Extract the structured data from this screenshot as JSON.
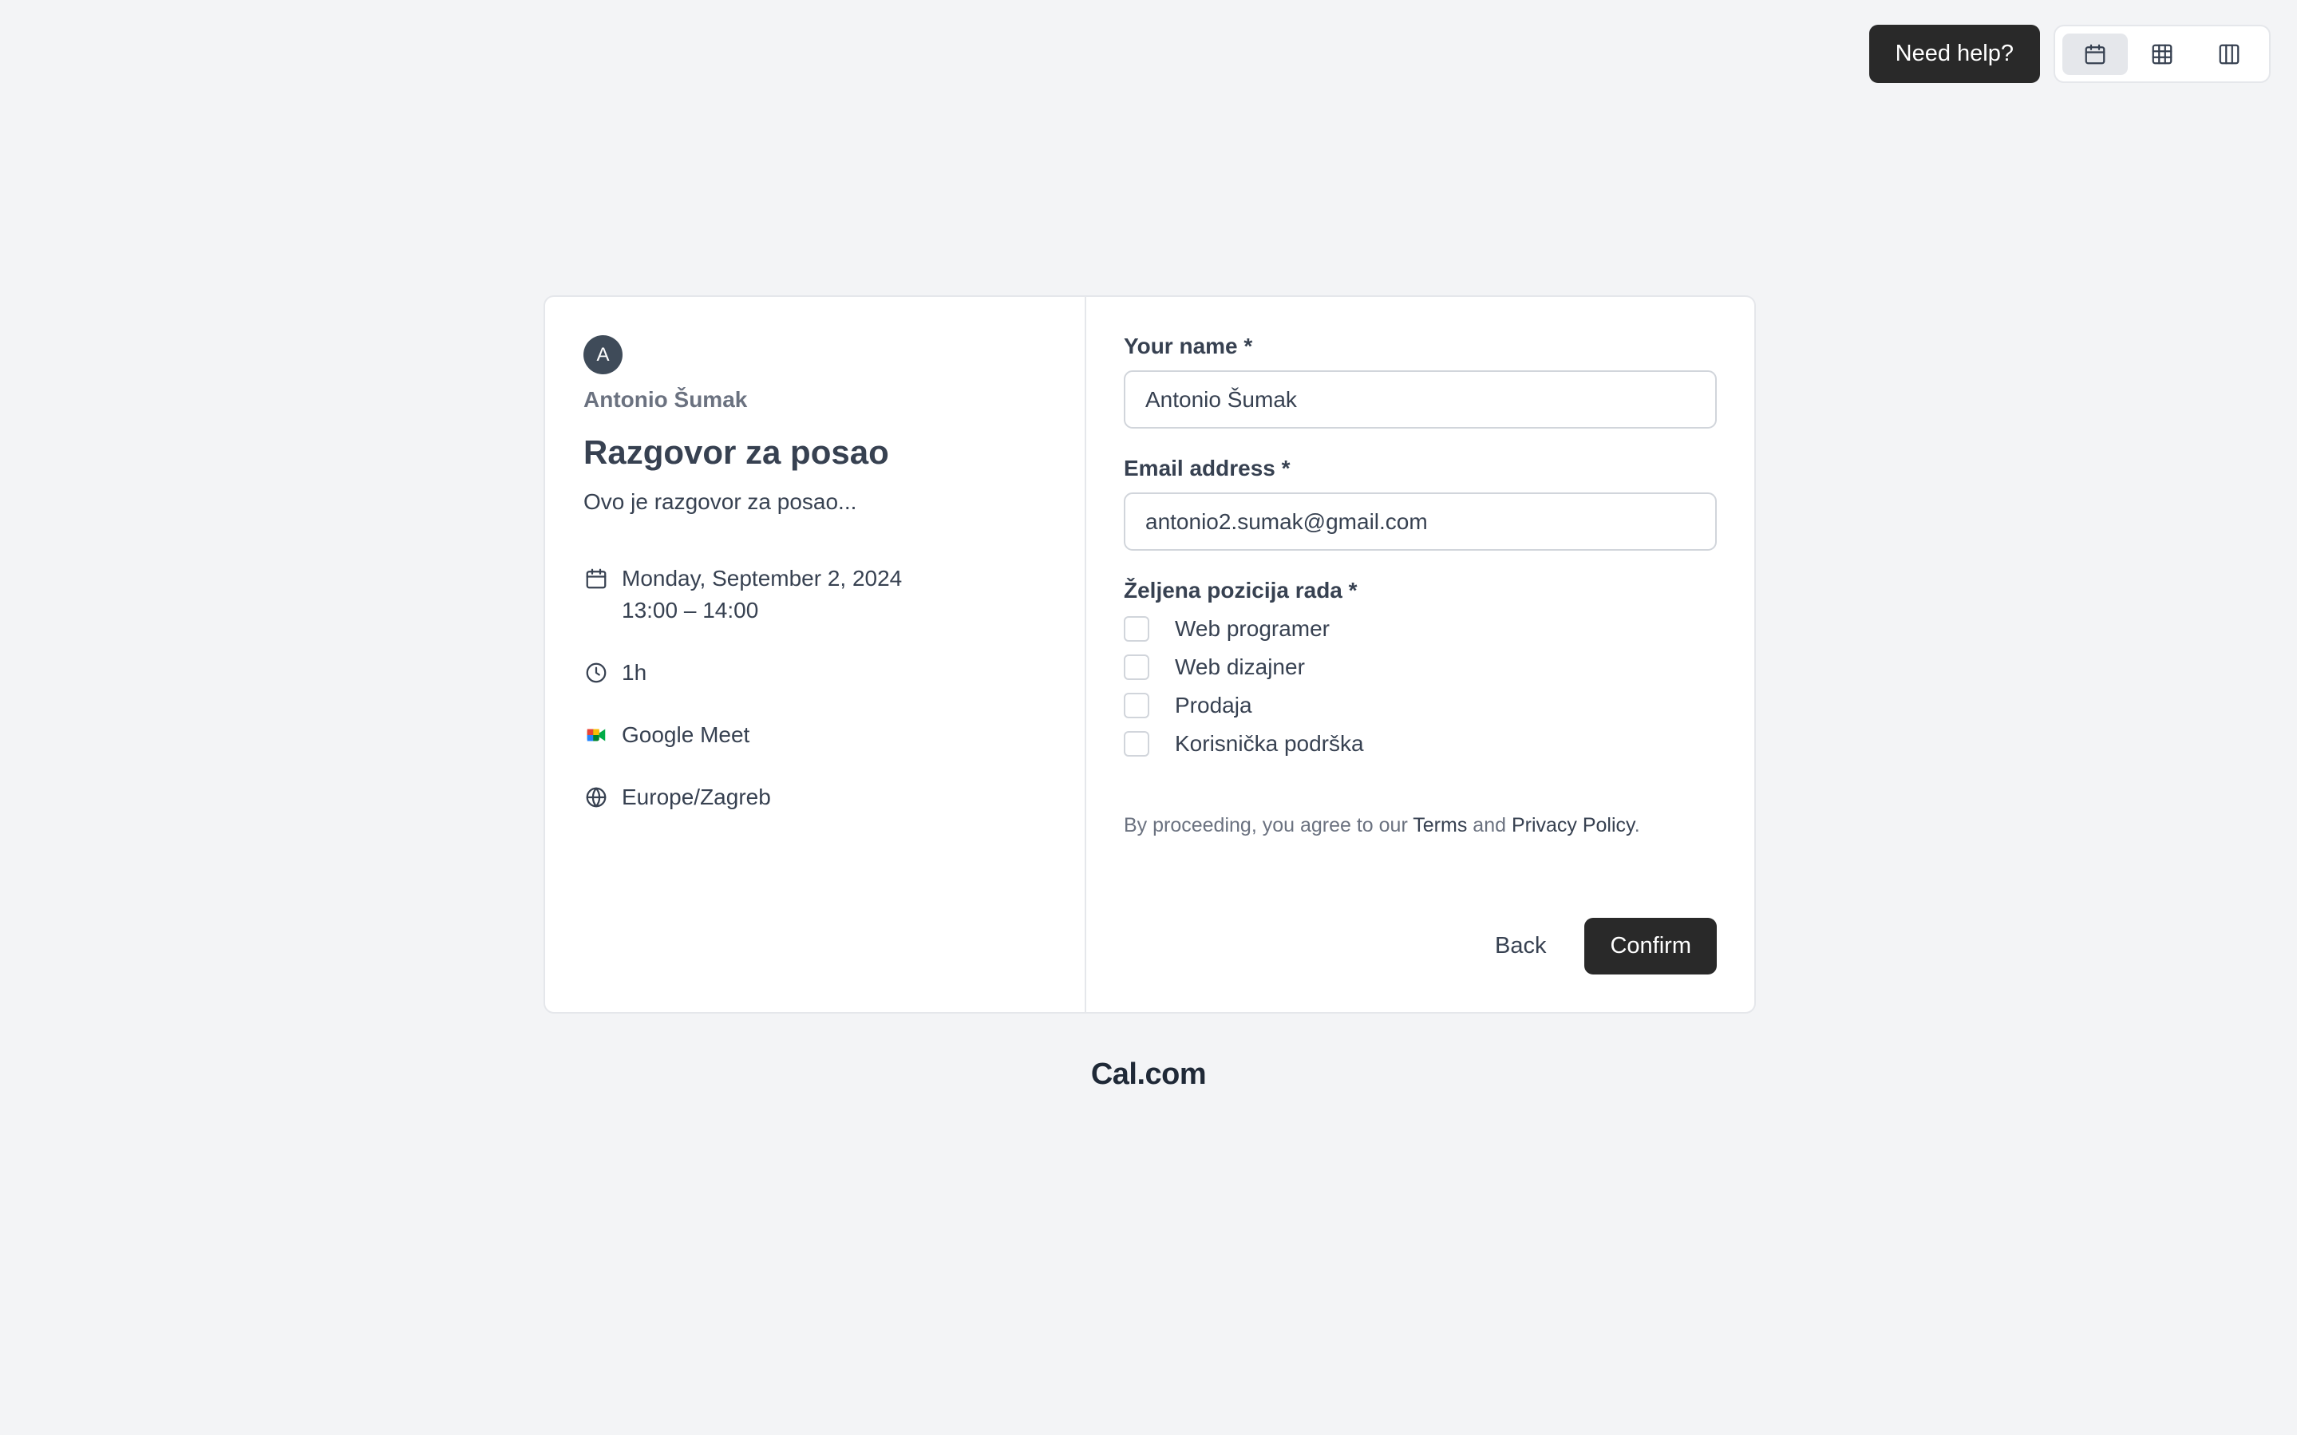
{
  "header": {
    "help_label": "Need help?",
    "view_options": [
      {
        "icon": "calendar-icon",
        "active": true
      },
      {
        "icon": "grid-icon",
        "active": false
      },
      {
        "icon": "columns-icon",
        "active": false
      }
    ]
  },
  "event": {
    "avatar_initial": "A",
    "organizer": "Antonio Šumak",
    "title": "Razgovor za posao",
    "description": "Ovo je razgovor za posao...",
    "date": "Monday, September 2, 2024",
    "time": "13:00 – 14:00",
    "duration": "1h",
    "location": "Google Meet",
    "timezone": "Europe/Zagreb"
  },
  "form": {
    "name_label": "Your name *",
    "name_value": "Antonio Šumak",
    "email_label": "Email address *",
    "email_value": "antonio2.sumak@gmail.com",
    "position_label": "Željena pozicija rada *",
    "positions": [
      "Web programer",
      "Web dizajner",
      "Prodaja",
      "Korisnička podrška"
    ],
    "terms_prefix": "By proceeding, you agree to our ",
    "terms_link": "Terms",
    "terms_and": " and ",
    "privacy_link": "Privacy Policy",
    "terms_suffix": ".",
    "back_label": "Back",
    "confirm_label": "Confirm"
  },
  "footer": {
    "brand": "Cal.com"
  },
  "colors": {
    "background": "#f3f4f6",
    "primary_button": "#292929",
    "border": "#e5e7eb",
    "avatar": "#3f4b59"
  }
}
